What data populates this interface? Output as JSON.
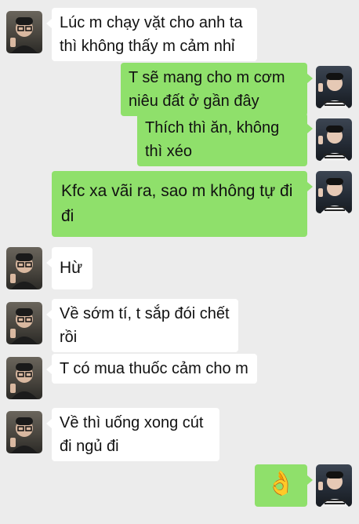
{
  "colors": {
    "background": "#ececec",
    "incoming_bubble": "#ffffff",
    "outgoing_bubble": "#8fe06b"
  },
  "messages": [
    {
      "sender": "contact",
      "text": "Lúc m chạy vặt cho anh ta thì không thấy m cảm nhỉ"
    },
    {
      "sender": "me",
      "text": "T sẽ mang cho m cơm niêu đất ở gần đây"
    },
    {
      "sender": "me",
      "text": "Thích thì ăn, không thì xéo"
    },
    {
      "sender": "me",
      "text": "Kfc xa vãi ra, sao m không tự đi đi"
    },
    {
      "sender": "contact",
      "text": "Hừ"
    },
    {
      "sender": "contact",
      "text": "Về sớm tí, t sắp đói chết rồi"
    },
    {
      "sender": "contact",
      "text": "T có mua thuốc cảm cho m"
    },
    {
      "sender": "contact",
      "text": "Về thì uống xong cút đi ngủ đi"
    },
    {
      "sender": "me",
      "text": "👌",
      "icon": "ok-hand-icon"
    }
  ]
}
